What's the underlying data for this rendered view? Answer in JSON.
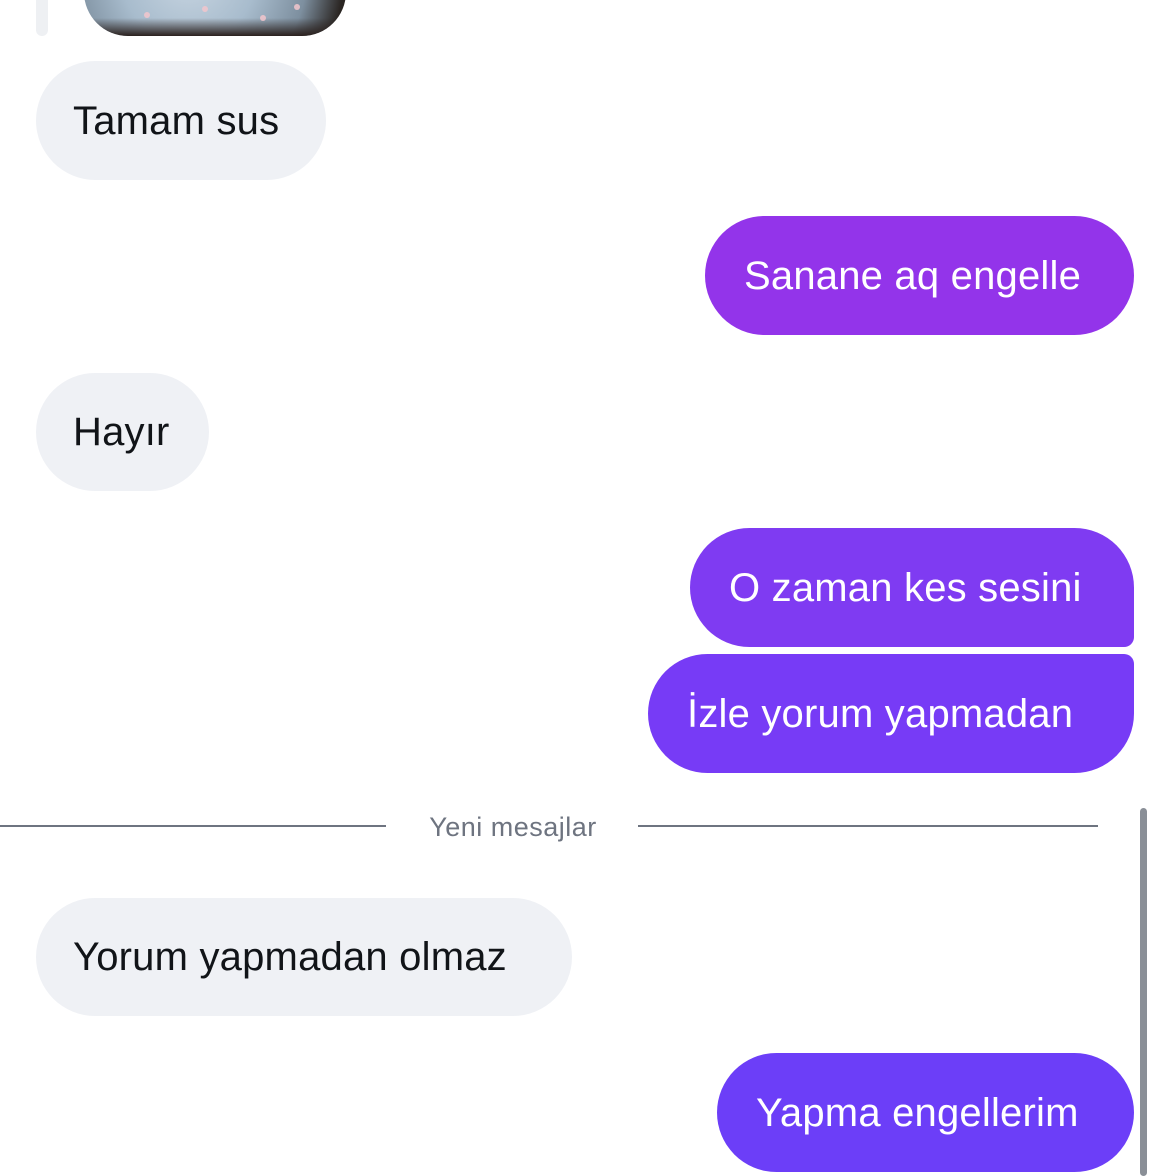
{
  "conversation": {
    "media": {
      "icon": "photo-attachment"
    },
    "messages": [
      {
        "id": "m1",
        "side": "incoming",
        "text": "Tamam sus"
      },
      {
        "id": "m2",
        "side": "outgoing",
        "text": "Sanane aq engelle"
      },
      {
        "id": "m3",
        "side": "incoming",
        "text": "Hayır"
      },
      {
        "id": "m4",
        "side": "outgoing",
        "text": "O zaman kes sesini"
      },
      {
        "id": "m5",
        "side": "outgoing",
        "text": "İzle yorum yapmadan"
      },
      {
        "id": "m6",
        "side": "incoming",
        "text": "Yorum yapmadan olmaz"
      },
      {
        "id": "m7",
        "side": "outgoing",
        "text": "Yapma engellerim"
      }
    ],
    "new_messages_divider": "Yeni mesajlar"
  },
  "colors": {
    "incoming_bubble": "#eff1f5",
    "incoming_text": "#111418",
    "outgoing_gradient_top": "#9b35ea",
    "outgoing_gradient_bottom": "#6a3ef8",
    "outgoing_text": "#ffffff",
    "divider": "#6e7480",
    "background": "#ffffff"
  }
}
